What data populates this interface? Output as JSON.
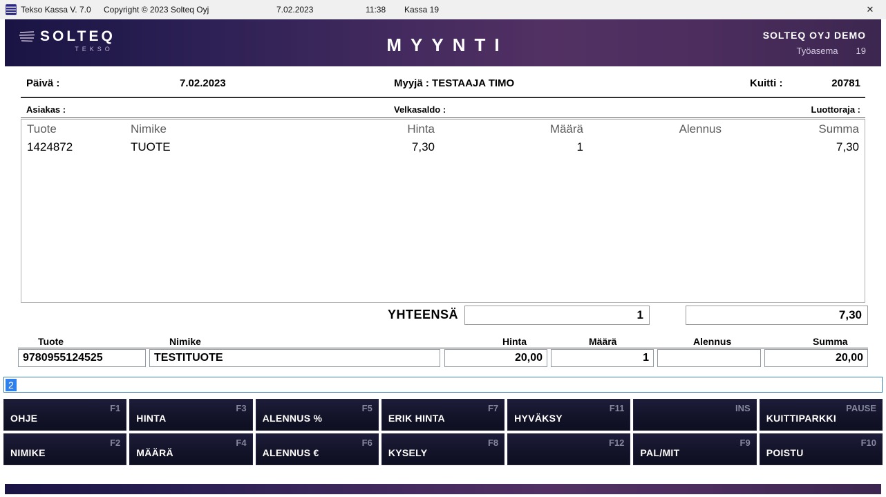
{
  "titlebar": {
    "app_title": "Tekso Kassa V. 7.0",
    "copyright": "Copyright © 2023 Solteq Oyj",
    "date": "7.02.2023",
    "time": "11:38",
    "register": "Kassa 19",
    "close_icon": "✕"
  },
  "header": {
    "logo": "SOLTEQ",
    "logo_sub": "TEKSO",
    "title": "MYYNTI",
    "company": "SOLTEQ OYJ DEMO",
    "workstation_label": "Työasema",
    "workstation_value": "19"
  },
  "sale_info": {
    "paiva_label": "Päivä :",
    "paiva_value": "7.02.2023",
    "myyja_label": "Myyjä :",
    "myyja_value": "TESTAAJA TIMO",
    "kuitti_label": "Kuitti :",
    "kuitti_value": "20781",
    "asiakas_label": "Asiakas :",
    "velkasaldo_label": "Velkasaldo :",
    "luottoraja_label": "Luottoraja :"
  },
  "items_table": {
    "columns": [
      "Tuote",
      "Nimike",
      "Hinta",
      "Määrä",
      "Alennus",
      "Summa"
    ],
    "rows": [
      {
        "tuote": "1424872",
        "nimike": "TUOTE",
        "hinta": "7,30",
        "maara": "1",
        "alennus": "",
        "summa": "7,30"
      }
    ]
  },
  "totals": {
    "label": "YHTEENSÄ",
    "quantity": "1",
    "sum": "7,30"
  },
  "entry": {
    "columns": [
      "Tuote",
      "Nimike",
      "Hinta",
      "Määrä",
      "Alennus",
      "Summa"
    ],
    "tuote": "9780955124525",
    "nimike": "TESTITUOTE",
    "hinta": "20,00",
    "maara": "1",
    "alennus": "",
    "summa": "20,00"
  },
  "command": {
    "value": "2"
  },
  "function_keys": {
    "row1": [
      {
        "label": "OHJE",
        "key": "F1"
      },
      {
        "label": "HINTA",
        "key": "F3"
      },
      {
        "label": "ALENNUS %",
        "key": "F5"
      },
      {
        "label": "ERIK HINTA",
        "key": "F7"
      },
      {
        "label": "HYVÄKSY",
        "key": "F11"
      },
      {
        "label": "",
        "key": "INS"
      },
      {
        "label": "KUITTIPARKKI",
        "key": "PAUSE"
      }
    ],
    "row2": [
      {
        "label": "NIMIKE",
        "key": "F2"
      },
      {
        "label": "MÄÄRÄ",
        "key": "F4"
      },
      {
        "label": "ALENNUS €",
        "key": "F6"
      },
      {
        "label": "KYSELY",
        "key": "F8"
      },
      {
        "label": "",
        "key": "F12"
      },
      {
        "label": "PAL/MIT",
        "key": "F9"
      },
      {
        "label": "POISTU",
        "key": "F10"
      }
    ]
  },
  "colors": {
    "header_gradient_start": "#191443",
    "header_gradient_mid": "#523063",
    "button_bg": "#13132b",
    "command_border": "#3c7fb1",
    "selection_bg": "#2f80ed",
    "titlebar_bg": "#f0f0f0"
  }
}
